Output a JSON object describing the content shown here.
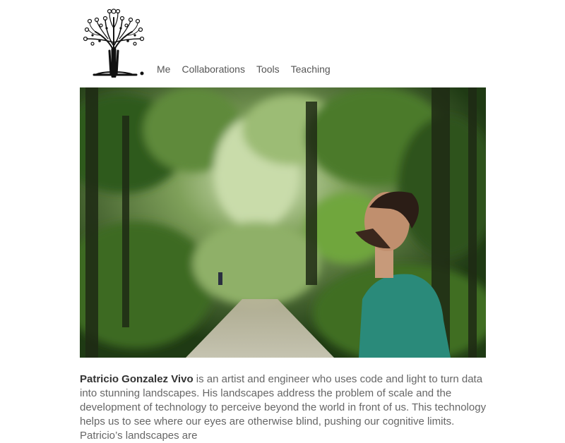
{
  "header": {
    "logo_icon": "tree-logo-icon",
    "nav": [
      {
        "label": "Me"
      },
      {
        "label": "Collaborations"
      },
      {
        "label": "Tools"
      },
      {
        "label": "Teaching"
      }
    ]
  },
  "hero": {
    "subject": "photo"
  },
  "bio": {
    "name": "Patricio Gonzalez Vivo",
    "text": " is an artist and engineer who uses code and light to turn data into stunning landscapes. His landscapes address the problem of scale and the development of technology to perceive beyond the world in front of us. This technology helps us to see where our eyes are otherwise blind, pushing our cognitive limits. Patricio’s landscapes are"
  },
  "colors": {
    "text": "#666666",
    "name": "#333333",
    "nav": "#555555"
  }
}
